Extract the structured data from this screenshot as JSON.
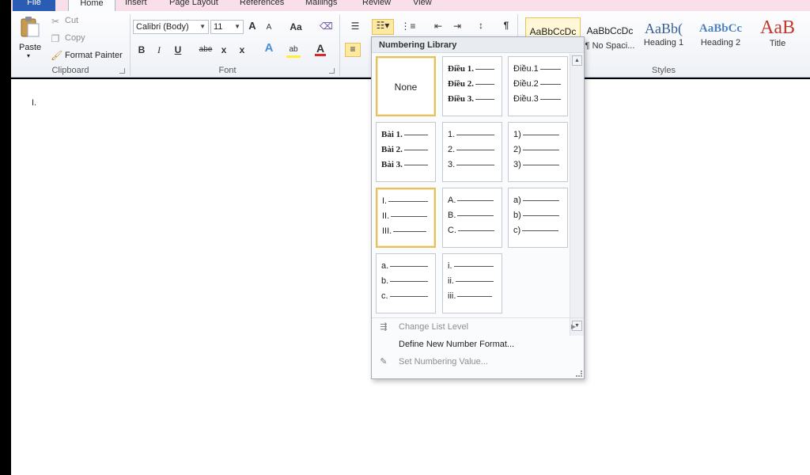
{
  "tabs": [
    {
      "label": "File"
    },
    {
      "label": "Home"
    },
    {
      "label": "Insert"
    },
    {
      "label": "Page Layout"
    },
    {
      "label": "References"
    },
    {
      "label": "Mailings"
    },
    {
      "label": "Review"
    },
    {
      "label": "View"
    }
  ],
  "clipboard": {
    "paste": "Paste",
    "cut": "Cut",
    "copy": "Copy",
    "format_painter": "Format Painter",
    "group": "Clipboard"
  },
  "font": {
    "name": "Calibri (Body)",
    "size": "11",
    "group": "Font",
    "grow": "A",
    "shrink": "A",
    "case": "Aa",
    "bold": "B",
    "italic": "I",
    "underline": "U",
    "strike": "abe",
    "sub": "x",
    "sup": "x",
    "effects": "A",
    "highlight": "ab",
    "color": "A"
  },
  "styles": {
    "group": "Styles",
    "items": [
      {
        "sample": "AaBbCcDc",
        "name": ""
      },
      {
        "sample": "AaBbCcDc",
        "name": "¶ No Spaci..."
      },
      {
        "sample": "AaBb(",
        "name": "Heading 1"
      },
      {
        "sample": "AaBbCc",
        "name": "Heading 2"
      },
      {
        "sample": "AaB",
        "name": "Title"
      }
    ]
  },
  "document": {
    "bullet": "I."
  },
  "numbering": {
    "header": "Numbering Library",
    "none_label": "None",
    "cells": [
      {
        "lines": [
          "Điều 1.",
          "Điều 2.",
          "Điều 3."
        ]
      },
      {
        "lines": [
          "Điều.1",
          "Điều.2",
          "Điều.3"
        ]
      },
      {
        "lines": [
          "Bài 1.",
          "Bài 2.",
          "Bài 3."
        ]
      },
      {
        "lines": [
          "1.",
          "2.",
          "3."
        ]
      },
      {
        "lines": [
          "1)",
          "2)",
          "3)"
        ]
      },
      {
        "lines": [
          "I.",
          "II.",
          "III."
        ]
      },
      {
        "lines": [
          "A.",
          "B.",
          "C."
        ]
      },
      {
        "lines": [
          "a)",
          "b)",
          "c)"
        ]
      },
      {
        "lines": [
          "a.",
          "b.",
          "c."
        ]
      },
      {
        "lines": [
          "i.",
          "ii.",
          "iii."
        ]
      }
    ],
    "menu": {
      "change_level": "Change List Level",
      "define_format": "Define New Number Format...",
      "set_value": "Set Numbering Value..."
    }
  },
  "colors": {
    "file_tab": "#2a5cb3",
    "selection_border": "#e5c05c",
    "heading_blue": "#365f91",
    "title_red": "#c0392b"
  }
}
